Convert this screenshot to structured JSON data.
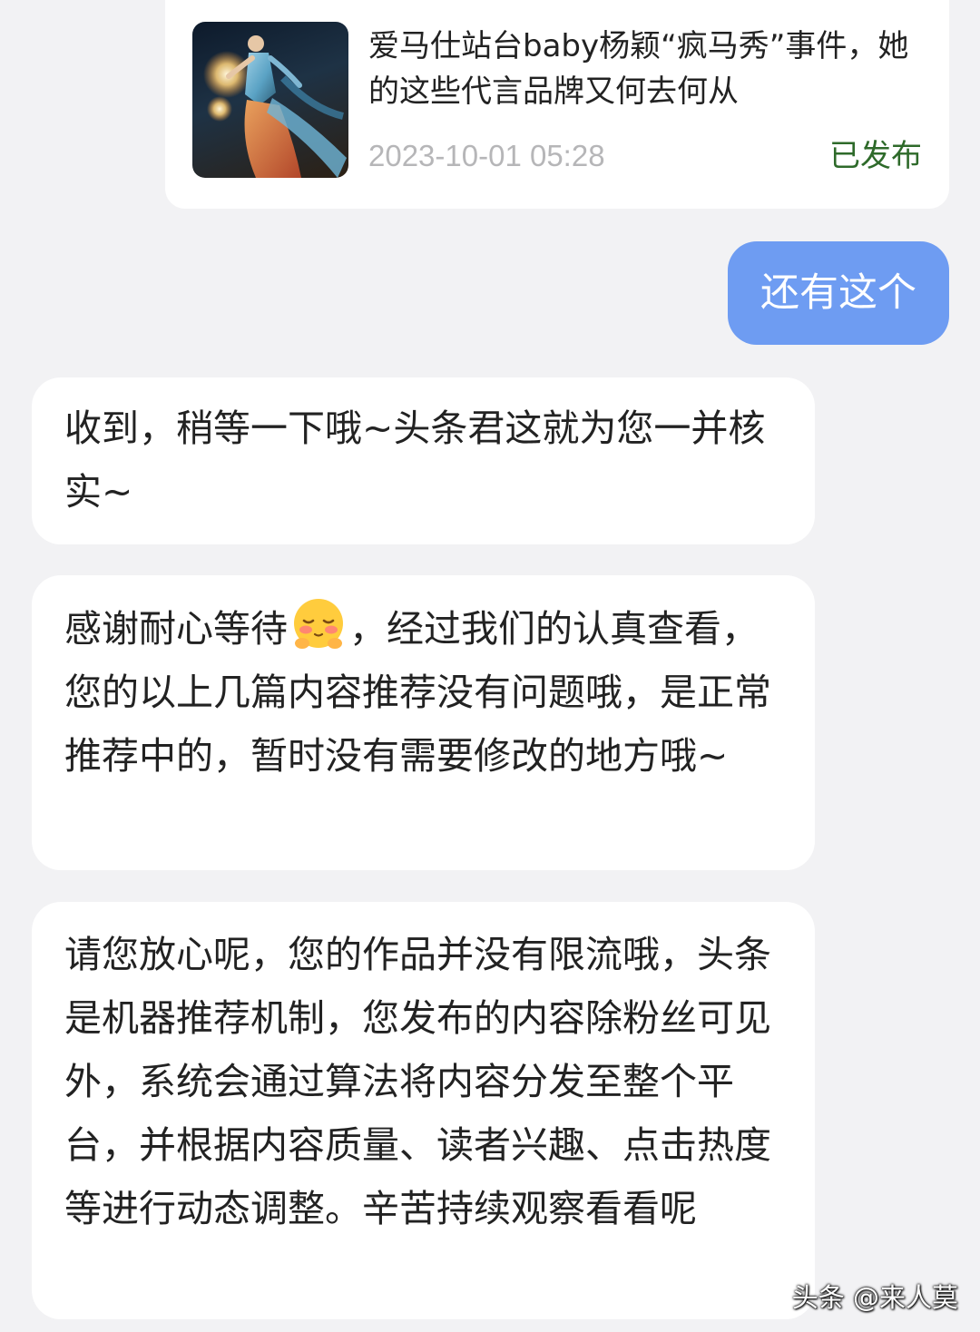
{
  "article": {
    "title": "爱马仕站台baby杨颖“疯马秀”事件，她的这些代言品牌又何去何从",
    "date": "2023-10-01 05:28",
    "status": "已发布",
    "status_color": "#2e6a2a"
  },
  "messages": [
    {
      "role": "user",
      "text": "还有这个"
    },
    {
      "role": "assistant",
      "text": "收到，稍等一下哦~头条君这就为您一并核实~"
    },
    {
      "role": "assistant",
      "text_before_emoji": "感谢耐心等待",
      "emoji": "blushing-face-icon",
      "text_after_emoji": "，经过我们的认真查看，您的以上几篇内容推荐没有问题哦，是正常推荐中的，暂时没有需要修改的地方哦~"
    },
    {
      "role": "assistant",
      "text": "请您放心呢，您的作品并没有限流哦，头条是机器推荐机制，您发布的内容除粉丝可见外，系统会通过算法将内容分发至整个平台，并根据内容质量、读者兴趣、点击热度等进行动态调整。辛苦持续观察看看呢"
    }
  ],
  "watermark": "头条 @来人莫",
  "colors": {
    "background": "#f2f2f4",
    "user_bubble": "#6e9cf2",
    "bot_bubble": "#ffffff"
  }
}
